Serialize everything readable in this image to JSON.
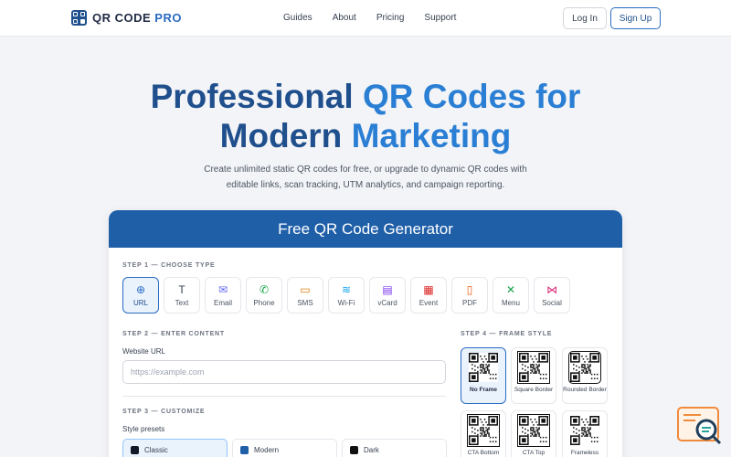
{
  "nav": {
    "logo_text_a": "QR CODE",
    "logo_text_b": "PRO",
    "links": [
      "Guides",
      "About",
      "Pricing",
      "Support"
    ],
    "login": "Log In",
    "signup": "Sign Up"
  },
  "hero": {
    "title_part1": "Professional ",
    "title_accent1": "QR Codes for",
    "title_part2": "Modern ",
    "title_accent2": "Marketing",
    "subtitle": "Create unlimited static QR codes for free, or upgrade to dynamic QR codes with editable links, scan tracking, UTM analytics, and campaign reporting."
  },
  "generator": {
    "title": "Free QR Code Generator",
    "step1": "STEP 1 — CHOOSE TYPE",
    "types": [
      {
        "label": "URL",
        "icon": "globe-icon",
        "glyph": "⊕",
        "color": "#2a6bc2"
      },
      {
        "label": "Text",
        "icon": "text-icon",
        "glyph": "T",
        "color": "#374151"
      },
      {
        "label": "Email",
        "icon": "email-icon",
        "glyph": "✉",
        "color": "#6366f1"
      },
      {
        "label": "Phone",
        "icon": "phone-icon",
        "glyph": "✆",
        "color": "#16a34a"
      },
      {
        "label": "SMS",
        "icon": "sms-icon",
        "glyph": "▭",
        "color": "#d97706"
      },
      {
        "label": "Wi-Fi",
        "icon": "wifi-icon",
        "glyph": "≋",
        "color": "#0ea5e9"
      },
      {
        "label": "vCard",
        "icon": "vcard-icon",
        "glyph": "▤",
        "color": "#7c3aed"
      },
      {
        "label": "Event",
        "icon": "calendar-icon",
        "glyph": "▦",
        "color": "#dc2626"
      },
      {
        "label": "PDF",
        "icon": "pdf-icon",
        "glyph": "▯",
        "color": "#ea580c"
      },
      {
        "label": "Menu",
        "icon": "menu-utensils-icon",
        "glyph": "✕",
        "color": "#16a34a"
      },
      {
        "label": "Social",
        "icon": "share-icon",
        "glyph": "⋈",
        "color": "#db2777"
      }
    ],
    "step2": "STEP 2 — ENTER CONTENT",
    "url_label": "Website URL",
    "url_placeholder": "https://example.com",
    "url_value": "",
    "step3": "STEP 3 — CUSTOMIZE",
    "presets_label": "Style presets",
    "presets": [
      {
        "label": "Classic",
        "color": "#111827"
      },
      {
        "label": "Modern",
        "color": "#1f5fa8"
      },
      {
        "label": "Dark",
        "color": "#111111"
      }
    ],
    "step4": "STEP 4 — FRAME STYLE",
    "frames": [
      {
        "label": "No Frame"
      },
      {
        "label": "Square Border"
      },
      {
        "label": "Rounded Border"
      },
      {
        "label": "CTA Bottom"
      },
      {
        "label": "CTA Top"
      },
      {
        "label": "Frameless"
      }
    ]
  },
  "colors": {
    "brand": "#1f4f8c",
    "accent": "#2a7fd4",
    "header_band": "#1f5fa8"
  }
}
